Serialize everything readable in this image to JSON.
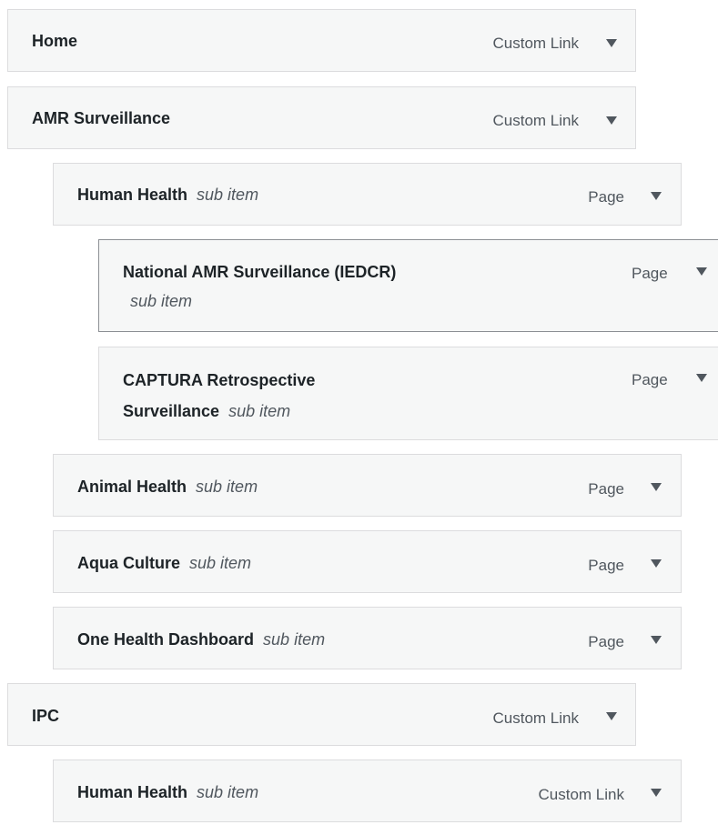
{
  "menu_items": [
    {
      "label": "Home",
      "sub": "",
      "type": "Custom Link"
    },
    {
      "label": "AMR Surveillance",
      "sub": "",
      "type": "Custom Link"
    },
    {
      "label": "Human Health",
      "sub": "sub item",
      "type": "Page"
    },
    {
      "label": "National AMR Surveillance (IEDCR)",
      "sub": "sub item",
      "type": "Page"
    },
    {
      "label_line1": "CAPTURA Retrospective",
      "label_line2": "Surveillance",
      "sub": "sub item",
      "type": "Page"
    },
    {
      "label": "Animal Health",
      "sub": "sub item",
      "type": "Page"
    },
    {
      "label": "Aqua Culture",
      "sub": "sub item",
      "type": "Page"
    },
    {
      "label": "One Health Dashboard",
      "sub": "sub item",
      "type": "Page"
    },
    {
      "label": "IPC",
      "sub": "",
      "type": "Custom Link"
    },
    {
      "label": "Human Health",
      "sub": "sub item",
      "type": "Custom Link"
    }
  ]
}
